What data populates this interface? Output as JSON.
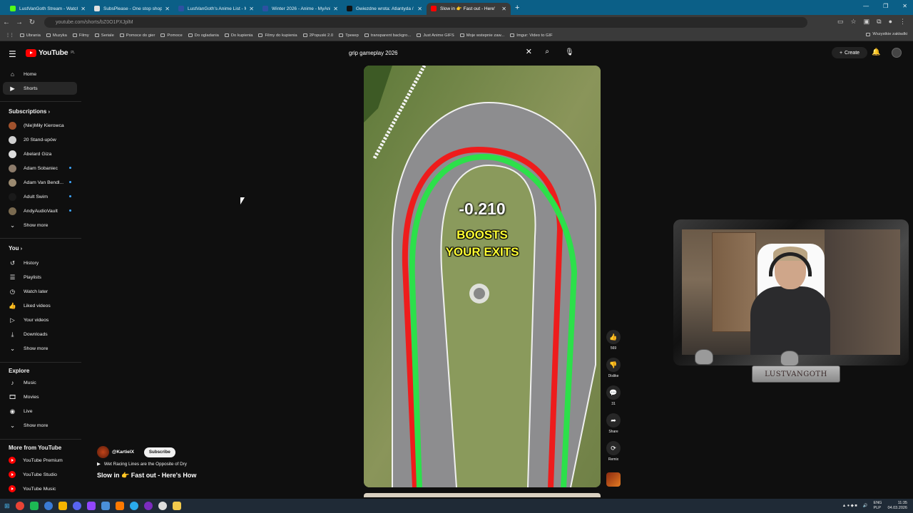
{
  "browser": {
    "tabs": [
      {
        "title": "LustVanGoth Stream - Watch Li",
        "color": "#53fc18"
      },
      {
        "title": "SubsPlease - One stop shop fo",
        "color": "#e0e0e0"
      },
      {
        "title": "LustVanGoth's Anime List - My",
        "color": "#2e51a2"
      },
      {
        "title": "Winter 2026 - Anime - MyAnim",
        "color": "#2e51a2"
      },
      {
        "title": "Gwiezdne wrota: Atlantyda / St",
        "color": "#111111"
      },
      {
        "title": "Slow in 👉 Fast out - Here'",
        "color": "#ff0000"
      }
    ],
    "url": "youtube.com/shorts/bZ0O1PXJplM",
    "bookmarks": [
      "Ubrania",
      "Muzyka",
      "Filmy",
      "Seriale",
      "Pomoce do gier",
      "Pomoce",
      "Do ogladania",
      "Do kupienia",
      "Filmy do kupienia",
      "2Popuski 2.0",
      "Трекер",
      "transparent backgro...",
      "Just Anime GIFS",
      "Moje wstepnie zaw...",
      "Imgur: Video to GIF"
    ],
    "bookmarks_right": "Wszystkie zakładki"
  },
  "header": {
    "logo_text": "YouTube",
    "logo_region": "PL",
    "search_value": "grip gameplay 2026",
    "create_label": "Create"
  },
  "sidebar": {
    "main": [
      {
        "label": "Home",
        "icon": "home-icon"
      },
      {
        "label": "Shorts",
        "icon": "shorts-icon"
      }
    ],
    "subscriptions_title": "Subscriptions",
    "subscriptions": [
      {
        "label": "(Nie)Miły Kierowca",
        "color": "#a0522d",
        "dot": false
      },
      {
        "label": "20 Stand-upów",
        "color": "#d0d0d0",
        "dot": false
      },
      {
        "label": "Abelard Giza",
        "color": "#dddddd",
        "dot": false
      },
      {
        "label": "Adam Sobaniec",
        "color": "#8c7b6a",
        "dot": true
      },
      {
        "label": "Adam Van Bendl...",
        "color": "#9b8a70",
        "dot": true
      },
      {
        "label": "Adult Swim",
        "color": "#1a1a1a",
        "dot": true
      },
      {
        "label": "AndyAudioVault",
        "color": "#7a6a50",
        "dot": true
      }
    ],
    "show_more": "Show more",
    "you_title": "You",
    "you": [
      {
        "label": "History",
        "icon": "history-icon"
      },
      {
        "label": "Playlists",
        "icon": "playlists-icon"
      },
      {
        "label": "Watch later",
        "icon": "watch-later-icon"
      },
      {
        "label": "Liked videos",
        "icon": "like-icon"
      },
      {
        "label": "Your videos",
        "icon": "your-videos-icon"
      },
      {
        "label": "Downloads",
        "icon": "download-icon"
      }
    ],
    "explore_title": "Explore",
    "explore": [
      {
        "label": "Music",
        "icon": "music-icon"
      },
      {
        "label": "Movies",
        "icon": "movies-icon"
      },
      {
        "label": "Live",
        "icon": "live-icon"
      }
    ],
    "more_title": "More from YouTube",
    "more": [
      "YouTube Premium",
      "YouTube Studio",
      "YouTube Music"
    ]
  },
  "short": {
    "overlay_time": "-0.210",
    "overlay_line1": "BOOSTS",
    "overlay_line2": "YOUR EXITS",
    "channel": "@KartielX",
    "subscribe_label": "Subscribe",
    "song": "Wet Racing Lines are the Opposite of Dry",
    "title": "Slow in 👉 Fast out - Here's How",
    "actions": {
      "like_count": "569",
      "dislike_label": "Dislike",
      "comments_count": "31",
      "share_label": "Share",
      "remix_label": "Remix"
    }
  },
  "stream_overlay": {
    "nameplate": "LUSTVANGOTH"
  },
  "taskbar": {
    "lang1": "ENG",
    "lang2": "PLP",
    "time": "11:35",
    "date": "04.03.2026"
  }
}
